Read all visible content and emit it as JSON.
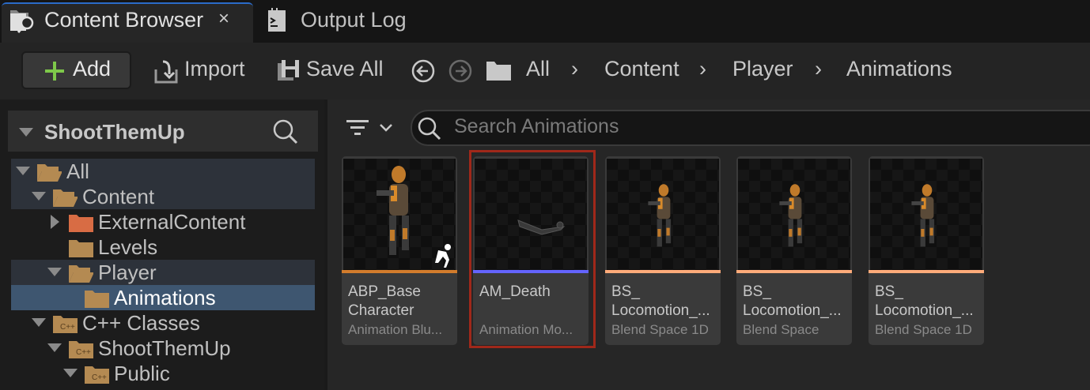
{
  "tabs": [
    {
      "label": "Content Browser",
      "icon": "content-browser-icon",
      "active": true
    },
    {
      "label": "Output Log",
      "icon": "output-log-icon"
    }
  ],
  "tab_close": "×",
  "toolbar": {
    "add": "Add",
    "import": "Import",
    "save_all": "Save All"
  },
  "breadcrumb": [
    "All",
    "Content",
    "Player",
    "Animations"
  ],
  "sidebar": {
    "title": "ShootThemUp",
    "items": [
      {
        "label": "All",
        "expanded": true
      },
      {
        "label": "Content",
        "expanded": true
      },
      {
        "label": "ExternalContent",
        "expanded": false
      },
      {
        "label": "Levels"
      },
      {
        "label": "Player",
        "expanded": true
      },
      {
        "label": "Animations",
        "selected": true
      },
      {
        "label": "C++ Classes",
        "expanded": true
      },
      {
        "label": "ShootThemUp",
        "expanded": true
      },
      {
        "label": "Public",
        "expanded": true
      }
    ]
  },
  "search": {
    "placeholder": "Search Animations"
  },
  "assets": [
    {
      "name": "ABP_Base\nCharacter",
      "type": "Animation Blu...",
      "color": "#d27c2c"
    },
    {
      "name": "AM_Death",
      "type": "Animation Mo...",
      "color": "#6464ff",
      "selected": true
    },
    {
      "name": "BS_\nLocomotion_...",
      "type": "Blend Space 1D",
      "color": "#ffab7a"
    },
    {
      "name": "BS_\nLocomotion_...",
      "type": "Blend Space",
      "color": "#ffab7a"
    },
    {
      "name": "BS_\nLocomotion_...",
      "type": "Blend Space 1D",
      "color": "#ffab7a"
    }
  ],
  "colors": {
    "accent_add": "#7ec84a",
    "selection_border": "#a0281a",
    "folder": "#b48a52",
    "external_folder": "#d86c44"
  }
}
